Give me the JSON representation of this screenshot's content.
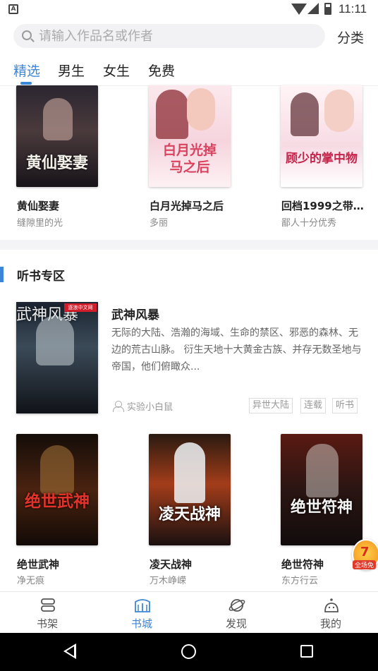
{
  "status_bar": {
    "time": "11:11",
    "notif_glyph": "A"
  },
  "search": {
    "placeholder": "请输入作品名或作者",
    "category_label": "分类"
  },
  "tabs": [
    {
      "label": "精选",
      "active": true
    },
    {
      "label": "男生",
      "active": false
    },
    {
      "label": "女生",
      "active": false
    },
    {
      "label": "免费",
      "active": false
    }
  ],
  "top_books": [
    {
      "title": "黄仙娶妻",
      "author": "缝隙里的光",
      "cover_text": "黄仙娶妻"
    },
    {
      "title": "白月光掉马之后",
      "author": "多丽",
      "cover_text": "白月光掉马之后"
    },
    {
      "title": "回档1999之带…",
      "author": "鄙人十分优秀",
      "cover_text": "顾少的掌中物"
    }
  ],
  "audio_section": {
    "title": "听书专区",
    "featured": {
      "title": "武神风暴",
      "description": "无际的大陆、浩瀚的海域、生命的禁区、邪恶的森林、无边的荒古山脉。 衍生天地十大黄金古族、并存无数圣地与帝国，他们俯瞰众...",
      "author": "实验小白鼠",
      "tags": [
        "异世大陆",
        "连载",
        "听书"
      ],
      "cover_text": "武神风暴",
      "cover_publisher": "逐浪中文网"
    },
    "books": [
      {
        "title": "绝世武神",
        "author": "净无痕",
        "cover_text": "绝世武神"
      },
      {
        "title": "凌天战神",
        "author": "万木峥嵘",
        "cover_text": "凌天战神"
      },
      {
        "title": "绝世符神",
        "author": "东方行云",
        "cover_text": "绝世符神"
      }
    ]
  },
  "float_badge": {
    "number": "7",
    "label": "全场免"
  },
  "bottom_nav": [
    {
      "label": "书架",
      "icon": "bookshelf-icon",
      "active": false
    },
    {
      "label": "书城",
      "icon": "bookstore-icon",
      "active": true
    },
    {
      "label": "发现",
      "icon": "planet-icon",
      "active": false
    },
    {
      "label": "我的",
      "icon": "profile-icon",
      "active": false
    }
  ],
  "colors": {
    "accent": "#3b86d8",
    "divider": "#f4f4f6"
  }
}
